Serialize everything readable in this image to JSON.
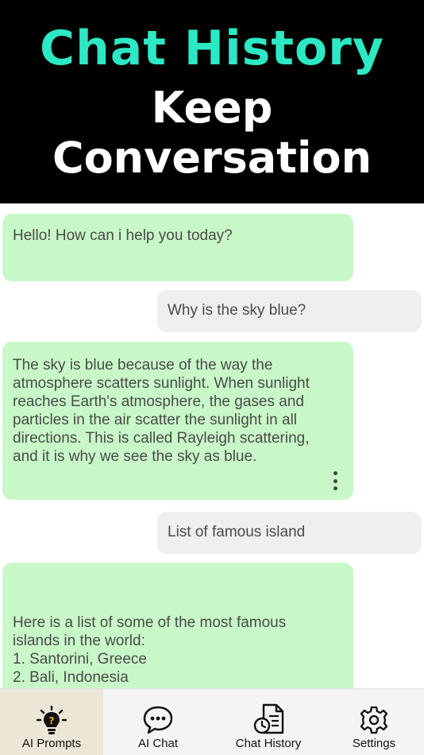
{
  "banner": {
    "title": "Chat History",
    "subtitle_line1": "Keep",
    "subtitle_line2": "Conversation"
  },
  "messages": [
    {
      "role": "bot",
      "text": "Hello! How can i help you today?"
    },
    {
      "role": "user",
      "text": "Why is the sky blue?"
    },
    {
      "role": "bot",
      "text": " The sky is blue because of the way the atmosphere scatters sunlight. When sunlight reaches Earth's atmosphere, the gases and particles in the air scatter the sunlight in all directions. This is called Rayleigh scattering, and it is why we see the sky as blue."
    },
    {
      "role": "user",
      "text": "List of famous island"
    },
    {
      "role": "bot",
      "lines": [
        "Here is a list of some of the most famous",
        "islands in the world:",
        "1. Santorini, Greece",
        "2. Bali, Indonesia"
      ]
    }
  ],
  "tabs": [
    {
      "label": "AI Prompts",
      "icon": "lightbulb-icon",
      "active": true
    },
    {
      "label": "AI Chat",
      "icon": "chat-bubble-icon",
      "active": false
    },
    {
      "label": "Chat History",
      "icon": "history-document-icon",
      "active": false
    },
    {
      "label": "Settings",
      "icon": "gear-icon",
      "active": false
    }
  ],
  "colors": {
    "banner_bg": "#000000",
    "title": "#2de8c4",
    "bot_bubble": "#c9f8c8",
    "user_bubble": "#efefef",
    "active_tab": "#ece6d6"
  }
}
